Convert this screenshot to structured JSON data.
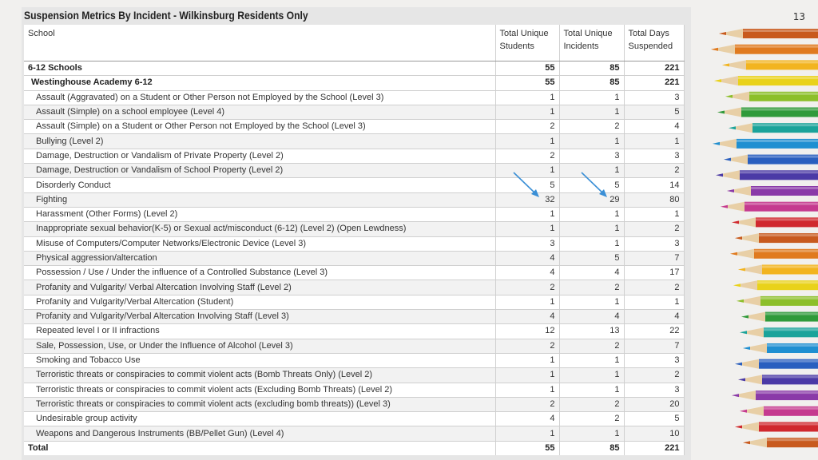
{
  "page_number": "13",
  "table": {
    "title": "Suspension Metrics By Incident - Wilkinsburg Residents Only",
    "headers": {
      "school": "School",
      "students": "Total Unique Students",
      "incidents": "Total Unique Incidents",
      "days": "Total Days Suspended"
    },
    "group": {
      "label": "6-12 Schools",
      "students": "55",
      "incidents": "85",
      "days": "221"
    },
    "subgroup": {
      "label": "Westinghouse Academy 6-12",
      "students": "55",
      "incidents": "85",
      "days": "221"
    },
    "rows": [
      {
        "label": "Assault (Aggravated) on a Student or Other Person not Employed by the School (Level 3)",
        "students": "1",
        "incidents": "1",
        "days": "3"
      },
      {
        "label": "Assault (Simple) on a school employee (Level 4)",
        "students": "1",
        "incidents": "1",
        "days": "5"
      },
      {
        "label": "Assault (Simple) on a Student or Other Person not Employed by the School (Level 3)",
        "students": "2",
        "incidents": "2",
        "days": "4"
      },
      {
        "label": "Bullying (Level 2)",
        "students": "1",
        "incidents": "1",
        "days": "1"
      },
      {
        "label": "Damage, Destruction or Vandalism of Private Property (Level 2)",
        "students": "2",
        "incidents": "3",
        "days": "3"
      },
      {
        "label": "Damage, Destruction or Vandalism of School Property (Level 2)",
        "students": "1",
        "incidents": "1",
        "days": "2"
      },
      {
        "label": "Disorderly Conduct",
        "students": "5",
        "incidents": "5",
        "days": "14"
      },
      {
        "label": "Fighting",
        "students": "32",
        "incidents": "29",
        "days": "80"
      },
      {
        "label": "Harassment (Other Forms) (Level 2)",
        "students": "1",
        "incidents": "1",
        "days": "1"
      },
      {
        "label": "Inappropriate sexual behavior(K-5) or Sexual act/misconduct (6-12) (Level 2) (Open Lewdness)",
        "students": "1",
        "incidents": "1",
        "days": "2"
      },
      {
        "label": "Misuse of Computers/Computer Networks/Electronic Device (Level 3)",
        "students": "3",
        "incidents": "1",
        "days": "3"
      },
      {
        "label": "Physical aggression/altercation",
        "students": "4",
        "incidents": "5",
        "days": "7"
      },
      {
        "label": "Possession / Use / Under the influence of a Controlled Substance (Level 3)",
        "students": "4",
        "incidents": "4",
        "days": "17"
      },
      {
        "label": "Profanity and Vulgarity/ Verbal Altercation Involving Staff (Level 2)",
        "students": "2",
        "incidents": "2",
        "days": "2"
      },
      {
        "label": "Profanity and Vulgarity/Verbal Altercation (Student)",
        "students": "1",
        "incidents": "1",
        "days": "1"
      },
      {
        "label": "Profanity and Vulgarity/Verbal Altercation Involving Staff (Level 3)",
        "students": "4",
        "incidents": "4",
        "days": "4"
      },
      {
        "label": "Repeated level I or II infractions",
        "students": "12",
        "incidents": "13",
        "days": "22"
      },
      {
        "label": "Sale, Possession, Use, or Under the Influence of Alcohol (Level 3)",
        "students": "2",
        "incidents": "2",
        "days": "7"
      },
      {
        "label": "Smoking and Tobacco Use",
        "students": "1",
        "incidents": "1",
        "days": "3"
      },
      {
        "label": "Terroristic threats or conspiracies to commit violent acts (Bomb Threats Only) (Level 2)",
        "students": "1",
        "incidents": "1",
        "days": "2"
      },
      {
        "label": "Terroristic threats or conspiracies to commit violent acts (Excluding Bomb Threats) (Level 2)",
        "students": "1",
        "incidents": "1",
        "days": "3"
      },
      {
        "label": "Terroristic threats or conspiracies to commit violent acts (excluding bomb threats)) (Level 3)",
        "students": "2",
        "incidents": "2",
        "days": "20"
      },
      {
        "label": "Undesirable group activity",
        "students": "4",
        "incidents": "2",
        "days": "5"
      },
      {
        "label": "Weapons and Dangerous Instruments (BB/Pellet Gun) (Level 4)",
        "students": "1",
        "incidents": "1",
        "days": "10"
      }
    ],
    "total": {
      "label": "Total",
      "students": "55",
      "incidents": "85",
      "days": "221"
    }
  },
  "colors": {
    "arrow": "#3a8fd6",
    "pencils": [
      "#c85a1e",
      "#e07a1f",
      "#f2b41f",
      "#e9d21a",
      "#8cbf2a",
      "#2f9a3a",
      "#1aa39a",
      "#1f8fd1",
      "#2a5fbf",
      "#4b3aa6",
      "#8a3aa8",
      "#c53a8f",
      "#d0282e"
    ]
  }
}
